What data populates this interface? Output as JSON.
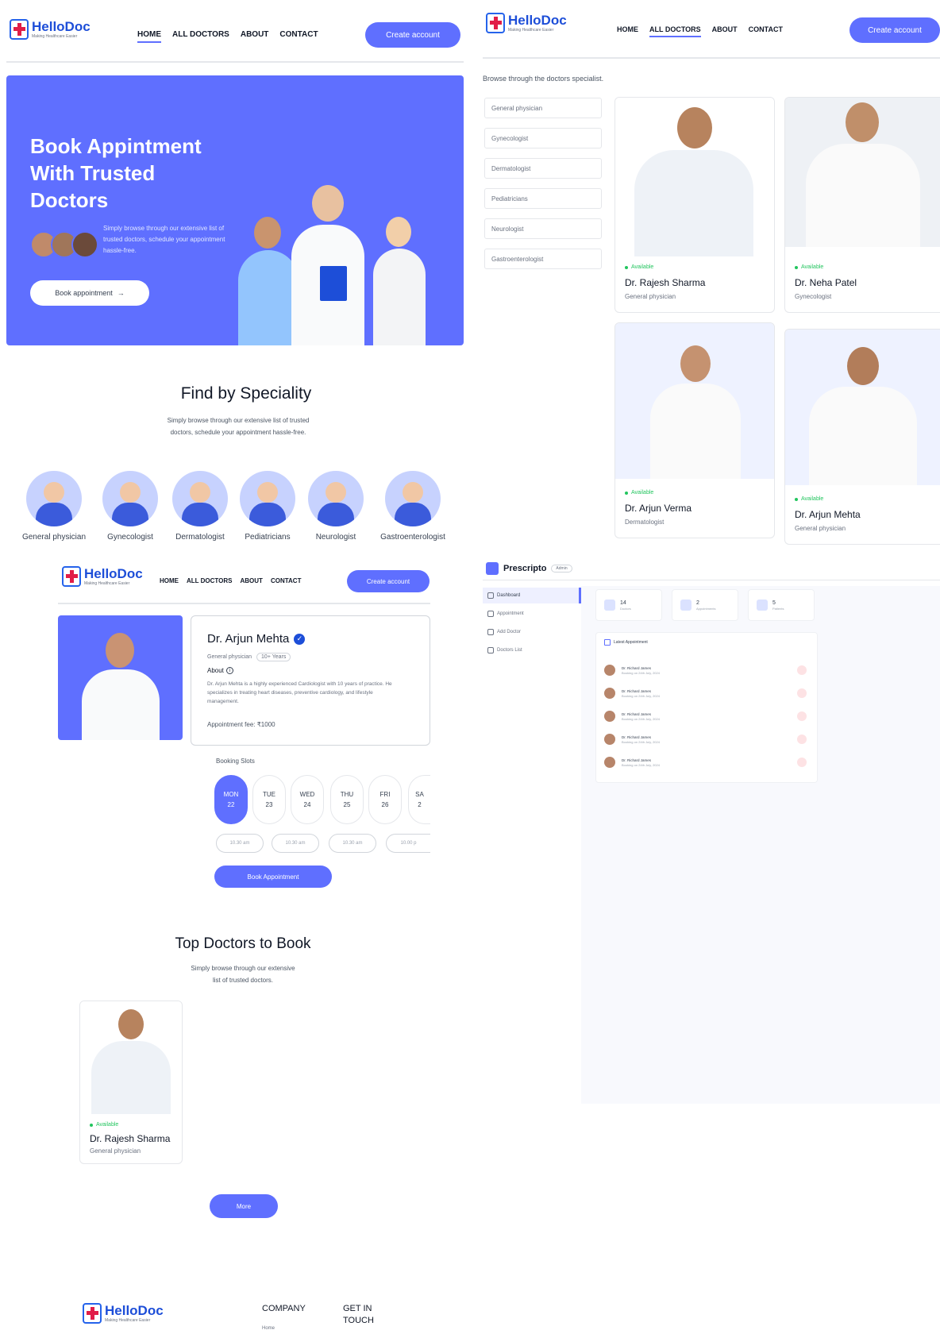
{
  "brand": {
    "name": "HelloDoc",
    "tagline": "Making Healthcare Easier"
  },
  "nav": {
    "home": "HOME",
    "all_doctors": "ALL DOCTORS",
    "about": "ABOUT",
    "contact": "CONTACT",
    "create_account": "Create account"
  },
  "hero": {
    "title": "Book Appintment With Trusted Doctors",
    "text": "Simply browse through our extensive list of trusted doctors, schedule your appointment hassle-free.",
    "button": "Book appointment",
    "button_icon": "arrow-right-icon"
  },
  "speciality": {
    "title": "Find by Speciality",
    "subtitle": "Simply browse through our extensive list of trusted doctors, schedule your appointment hassle-free.",
    "items": [
      "General physician",
      "Gynecologist",
      "Dermatologist",
      "Pediatricians",
      "Neurologist",
      "Gastroenterologist"
    ]
  },
  "profile": {
    "name": "Dr. Arjun Mehta",
    "degree": "General physician",
    "experience": "10+ Years",
    "about_label": "About",
    "about_text": "Dr. Arjun Mehta is a highly experienced Cardiologist with 10 years of practice. He specializes in treating heart diseases, preventive cardiology, and lifestyle management.",
    "fee": "Appointment fee: ₹1000",
    "slots_title": "Booking Slots",
    "days": [
      {
        "d": "MON",
        "n": "22"
      },
      {
        "d": "TUE",
        "n": "23"
      },
      {
        "d": "WED",
        "n": "24"
      },
      {
        "d": "THU",
        "n": "25"
      },
      {
        "d": "FRI",
        "n": "26"
      },
      {
        "d": "SA",
        "n": "2"
      }
    ],
    "times": [
      "10.30 am",
      "10.30 am",
      "10.30 am",
      "10.00 p"
    ],
    "book_button": "Book Appointment"
  },
  "top_doctors": {
    "title": "Top Doctors to Book",
    "subtitle": "Simply browse through our extensive list of trusted doctors.",
    "more_button": "More"
  },
  "doctors_page": {
    "browse_text": "Browse through the doctors specialist.",
    "filters": [
      "General physician",
      "Gynecologist",
      "Dermatologist",
      "Pediatricians",
      "Neurologist",
      "Gastroenterologist"
    ],
    "available": "Available",
    "cards": [
      {
        "name": "Dr. Rajesh Sharma",
        "speciality": "General physician"
      },
      {
        "name": "Dr. Neha Patel",
        "speciality": "Gynecologist"
      },
      {
        "name": "Dr. Arjun Verma",
        "speciality": "Dermatologist"
      },
      {
        "name": "Dr. Arjun Mehta",
        "speciality": "General physician"
      }
    ]
  },
  "admin": {
    "brand": "Prescripto",
    "role": "Admin",
    "sidebar": [
      "Dashboard",
      "Appointment",
      "Add Doctor",
      "Doctors List"
    ],
    "stats": [
      {
        "value": "14",
        "label": "Doctors"
      },
      {
        "value": "2",
        "label": "Appointments"
      },
      {
        "value": "5",
        "label": "Patients"
      }
    ],
    "latest_title": "Latest Appointment",
    "appointments": [
      {
        "name": "Dr. Richard James",
        "date": "Booking on 24th July, 2024"
      },
      {
        "name": "Dr. Richard James",
        "date": "Booking on 24th July, 2024"
      },
      {
        "name": "Dr. Richard James",
        "date": "Booking on 24th July, 2024"
      },
      {
        "name": "Dr. Richard James",
        "date": "Booking on 24th July, 2024"
      },
      {
        "name": "Dr. Richard James",
        "date": "Booking on 24th July, 2024"
      }
    ]
  },
  "footer": {
    "company": "COMPANY",
    "get_in_touch": "GET IN TOUCH",
    "home_link": "Home"
  },
  "colors": {
    "primary": "#5f6fff",
    "available": "#22c55e",
    "logo": "#1d4ed8",
    "logo_cross": "#e11d48"
  }
}
